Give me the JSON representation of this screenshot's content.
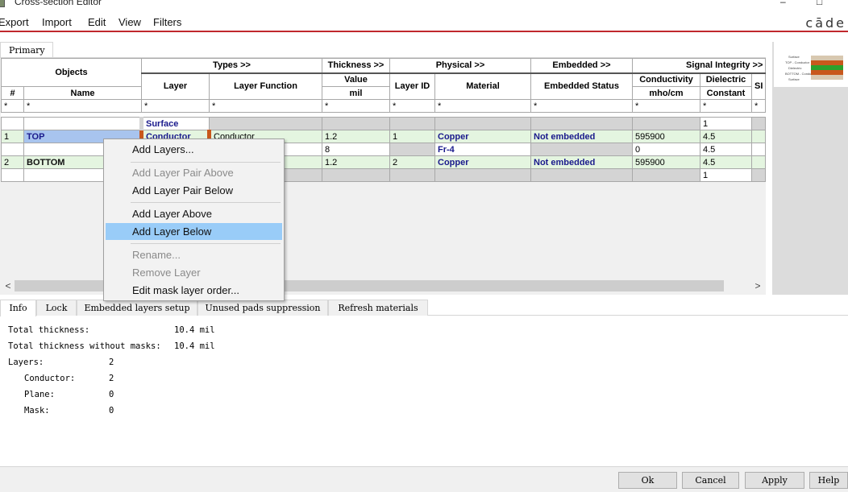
{
  "window": {
    "title": "Cross-section Editor",
    "minimize": "–",
    "maximize": "□"
  },
  "brand": "cāde",
  "menu": [
    "Export",
    "Import",
    "Edit",
    "View",
    "Filters"
  ],
  "primary_tab": "Primary",
  "headers": {
    "groups": {
      "objects": "Objects",
      "types": "Types >>",
      "thickness": "Thickness >>",
      "physical": "Physical >>",
      "embedded": "Embedded >>",
      "signal": "Signal Integrity >>"
    },
    "cols": {
      "num": "#",
      "name": "Name",
      "layer": "Layer",
      "layer_function": "Layer Function",
      "value": "Value",
      "unit": "mil",
      "layer_id": "Layer ID",
      "material": "Material",
      "embedded_status": "Embedded Status",
      "conductivity": "Conductivity",
      "conductivity_unit": "mho/cm",
      "dielectric_1": "Dielectric",
      "dielectric_2": "Constant",
      "cut": "SI"
    }
  },
  "filter_char": "*",
  "rows": [
    {
      "num": "",
      "name": "",
      "layer": "Surface",
      "function": "",
      "thickness": "",
      "layer_id": "",
      "material": "",
      "embedded": "",
      "conductivity": "",
      "dielectric": "1"
    },
    {
      "num": "1",
      "name": "TOP",
      "layer": "Conductor",
      "function": "Conductor",
      "thickness": "1.2",
      "layer_id": "1",
      "material": "Copper",
      "embedded": "Not embedded",
      "conductivity": "595900",
      "dielectric": "4.5"
    },
    {
      "num": "",
      "name": "",
      "layer": "",
      "function": "",
      "thickness": "8",
      "layer_id": "",
      "material": "Fr-4",
      "embedded": "",
      "conductivity": "0",
      "dielectric": "4.5"
    },
    {
      "num": "2",
      "name": "BOTTOM",
      "layer": "",
      "function": "",
      "thickness": "1.2",
      "layer_id": "2",
      "material": "Copper",
      "embedded": "Not embedded",
      "conductivity": "595900",
      "dielectric": "4.5"
    },
    {
      "num": "",
      "name": "",
      "layer": "",
      "function": "",
      "thickness": "",
      "layer_id": "",
      "material": "",
      "embedded": "",
      "conductivity": "",
      "dielectric": "1"
    }
  ],
  "context_menu": {
    "add_layers": "Add Layers...",
    "add_pair_above": "Add Layer Pair Above",
    "add_pair_below": "Add Layer Pair Below",
    "add_above": "Add Layer Above",
    "add_below": "Add Layer Below",
    "rename": "Rename...",
    "remove": "Remove Layer",
    "edit_mask": "Edit mask layer order..."
  },
  "preview": {
    "lines": [
      "Surface",
      "TOP - Conductor",
      "Dielectric",
      "BOTTOM - Conductor",
      "Surface"
    ],
    "colors": {
      "copper": "#c8581c",
      "dielectric": "#2ca02c",
      "surface": "#d8c8b0"
    }
  },
  "bottom_tabs": [
    "Info",
    "Lock",
    "Embedded layers setup",
    "Unused pads suppression",
    "Refresh materials"
  ],
  "info": {
    "total_thickness_label": "Total thickness:",
    "total_thickness_value": "10.4 mil",
    "without_masks_label": "Total thickness without masks:",
    "without_masks_value": "10.4 mil",
    "layers_label": "Layers:",
    "layers_value": "2",
    "conductor_label": "Conductor:",
    "conductor_value": "2",
    "plane_label": "Plane:",
    "plane_value": "0",
    "mask_label": "Mask:",
    "mask_value": "0"
  },
  "footer": {
    "ok": "Ok",
    "cancel": "Cancel",
    "apply": "Apply",
    "help": "Help"
  },
  "scroll": {
    "left": "<",
    "right": ">"
  }
}
